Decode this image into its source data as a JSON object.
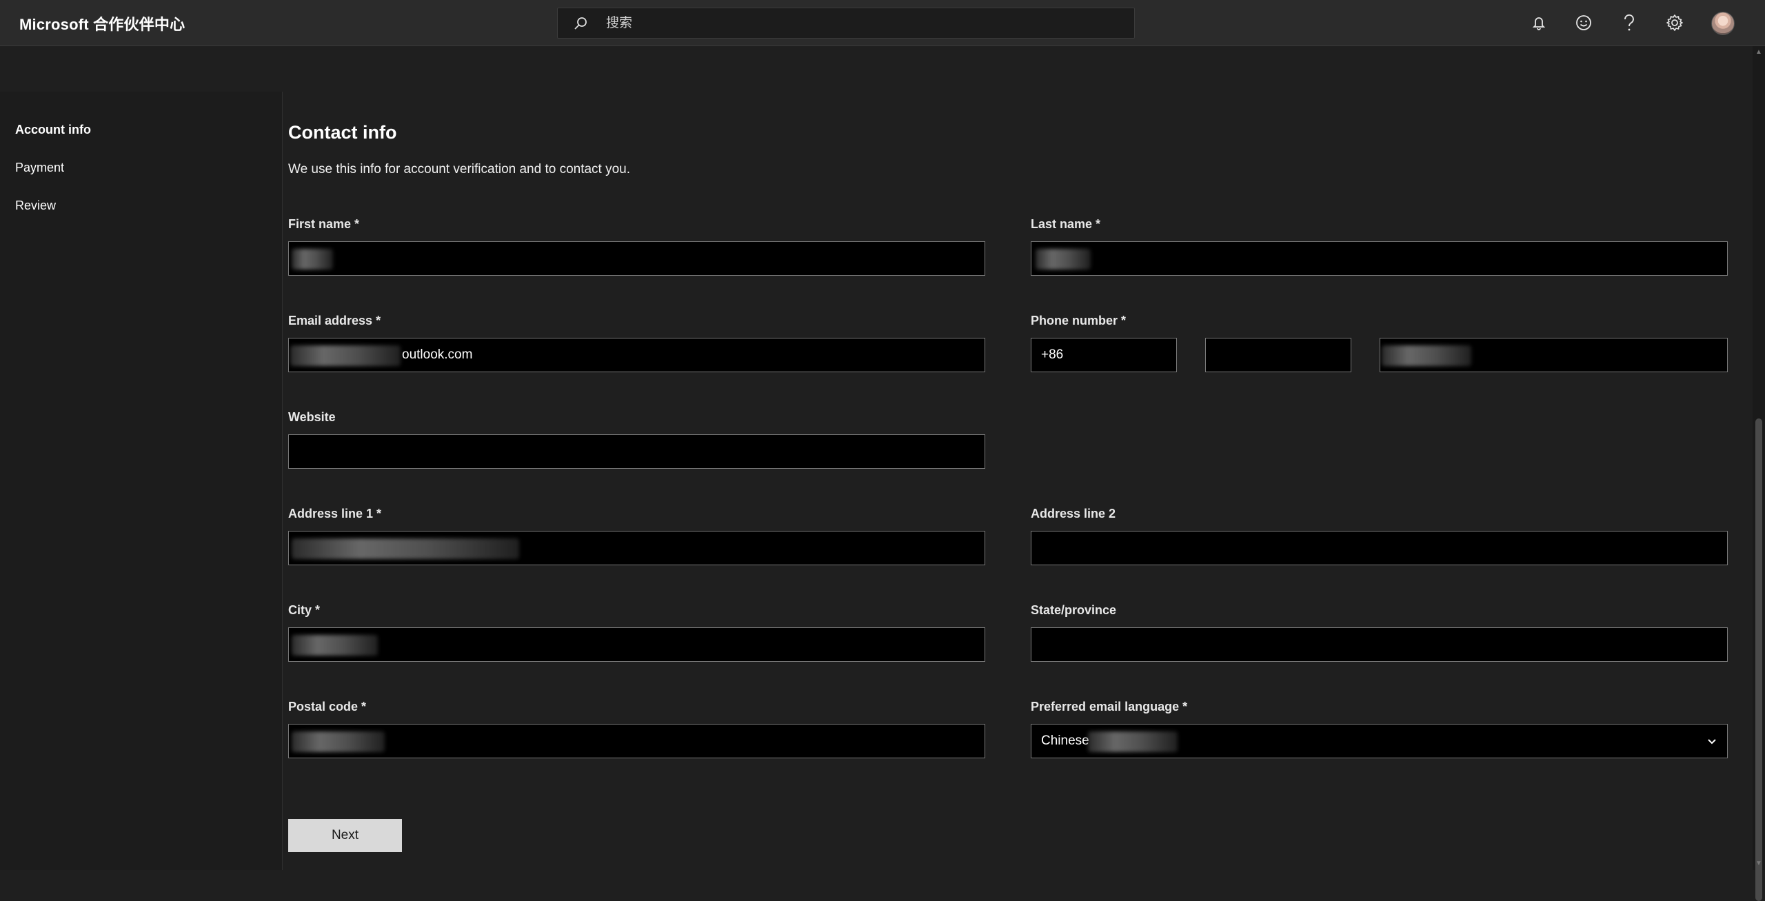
{
  "header": {
    "brand": "Microsoft 合作伙伴中心",
    "search_placeholder": "搜索",
    "icons": [
      "bell-icon",
      "smiley-icon",
      "help-icon",
      "gear-icon",
      "avatar"
    ]
  },
  "sidebar": {
    "items": [
      {
        "label": "Account info",
        "active": true
      },
      {
        "label": "Payment",
        "active": false
      },
      {
        "label": "Review",
        "active": false
      }
    ]
  },
  "form": {
    "title": "Contact info",
    "subtitle": "We use this info for account verification and to contact you.",
    "first_name": {
      "label": "First name *",
      "value": ""
    },
    "last_name": {
      "label": "Last name *",
      "value": ""
    },
    "email": {
      "label": "Email address *",
      "value_visible_part": "outlook.com"
    },
    "phone": {
      "label": "Phone number *",
      "country_code": "+86",
      "area_code": "",
      "number": ""
    },
    "website": {
      "label": "Website",
      "value": ""
    },
    "address1": {
      "label": "Address line 1 *",
      "value": ""
    },
    "address2": {
      "label": "Address line 2",
      "value": ""
    },
    "city": {
      "label": "City *",
      "value": ""
    },
    "state": {
      "label": "State/province",
      "value": ""
    },
    "postal": {
      "label": "Postal code *",
      "value": ""
    },
    "language": {
      "label": "Preferred email language *",
      "value_visible_part": "Chinese"
    },
    "next_label": "Next"
  },
  "colors": {
    "background": "#1f1f1f",
    "topbar": "#2b2b2b",
    "input_bg": "#000000",
    "input_border": "#7a7a7a",
    "button_bg": "#d9d9d9"
  }
}
